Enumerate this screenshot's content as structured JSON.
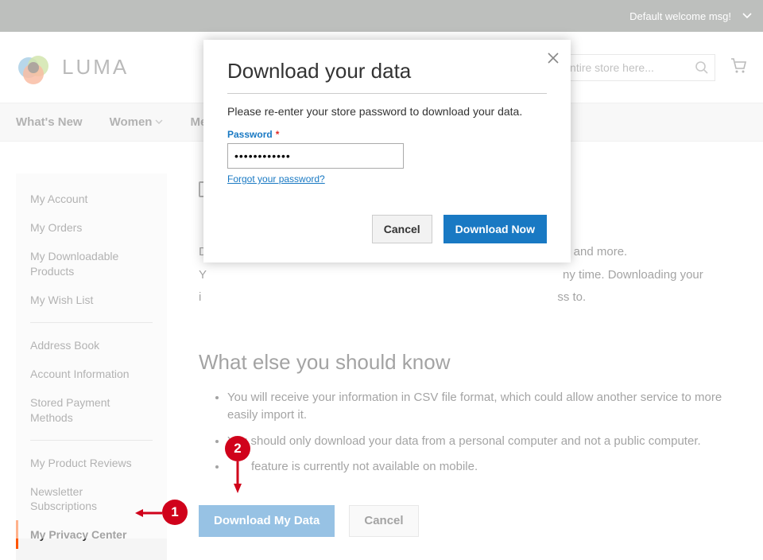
{
  "topbar": {
    "welcome": "Default welcome msg!"
  },
  "brand": {
    "name": "LUMA"
  },
  "search": {
    "placeholder": "Search entire store here..."
  },
  "nav": [
    {
      "label": "What's New",
      "chev": false
    },
    {
      "label": "Women",
      "chev": true
    },
    {
      "label": "Men",
      "chev": true
    }
  ],
  "sidebar": {
    "group1": [
      "My Account",
      "My Orders",
      "My Downloadable Products",
      "My Wish List"
    ],
    "group2": [
      "Address Book",
      "Account Information",
      "Stored Payment Methods"
    ],
    "group3": [
      "My Product Reviews",
      "Newsletter Subscriptions",
      "My Privacy Center"
    ],
    "active": "My Privacy Center"
  },
  "content": {
    "para1_tail": "ews and more.",
    "para2_lead": "Y",
    "para2_mid": "ny time. Downloading your",
    "para3_lead": "i",
    "para3_tail": "ss to.",
    "h2": "What else you should know",
    "li1": "You will receive your information in CSV file format, which could allow another service to more easily import it.",
    "li2": "You should only download your data from a personal computer and not a public computer.",
    "li3": "feature is currently not available on mobile.",
    "download_btn": "Download My Data",
    "cancel_btn": "Cancel"
  },
  "modal": {
    "title": "Download your data",
    "msg": "Please re-enter your store password to download your data.",
    "password_label": "Password",
    "password_value": "••••••••••••",
    "forgot": "Forgot your password?",
    "cancel": "Cancel",
    "submit": "Download Now"
  },
  "annotations": {
    "a1": "1",
    "a2": "2"
  }
}
